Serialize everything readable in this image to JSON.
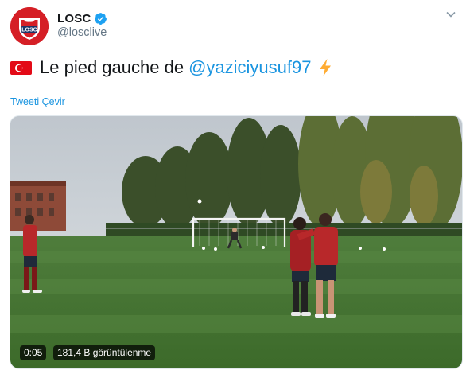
{
  "author": {
    "display_name": "LOSC",
    "handle": "@losclive",
    "logo_text": "LOSC",
    "verified": true,
    "brand_color": "#d51f26"
  },
  "tweet": {
    "flag_icon": "turkey-flag",
    "text": "Le pied gauche de",
    "mention": "@yaziciyusuf97",
    "trailing_icon": "lightning-bolt",
    "translate_label": "Tweeti Çevir",
    "link_color": "#1b95e0"
  },
  "video": {
    "timestamp": "0:05",
    "views": "181,4 B görüntülenme"
  }
}
